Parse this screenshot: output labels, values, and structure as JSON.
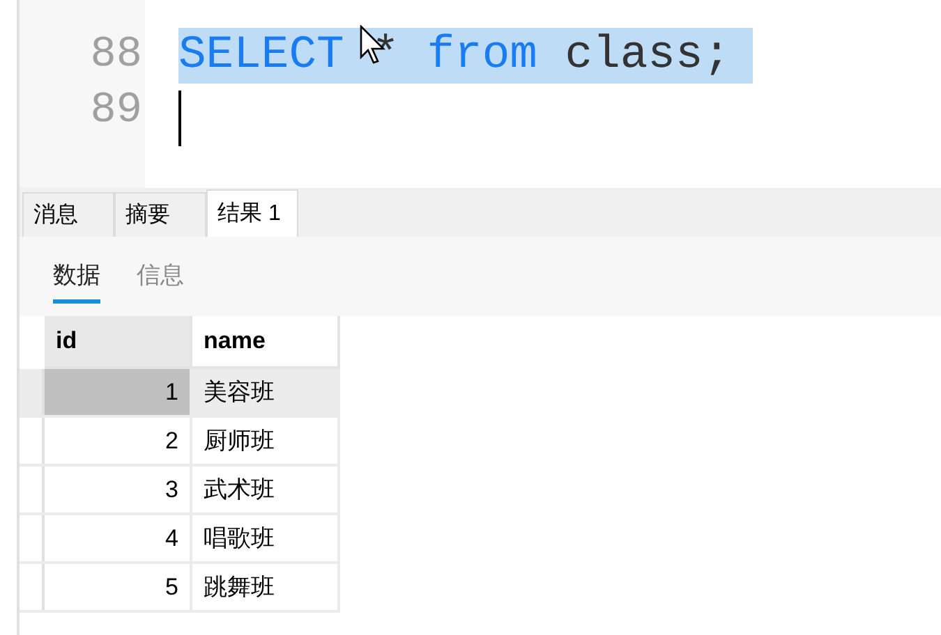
{
  "editor": {
    "lines": [
      {
        "number": "88",
        "tokens": [
          {
            "kind": "keyword",
            "text": "SELECT"
          },
          {
            "kind": "plain",
            "text": " * "
          },
          {
            "kind": "keyword",
            "text": "from"
          },
          {
            "kind": "plain",
            "text": " class;"
          }
        ],
        "selected": true,
        "caret": false
      },
      {
        "number": "89",
        "selected": false,
        "caret": true
      }
    ]
  },
  "result_tabs": [
    {
      "label": "消息",
      "selected": false
    },
    {
      "label": "摘要",
      "selected": false
    },
    {
      "label": "结果 1",
      "selected": true
    }
  ],
  "view_tabs": [
    {
      "label": "数据",
      "selected": true
    },
    {
      "label": "信息",
      "selected": false
    }
  ],
  "table": {
    "columns": [
      "id",
      "name"
    ],
    "rows": [
      {
        "cells": [
          "1",
          "美容班"
        ],
        "selected": true
      },
      {
        "cells": [
          "2",
          "厨师班"
        ],
        "selected": false
      },
      {
        "cells": [
          "3",
          "武术班"
        ],
        "selected": false
      },
      {
        "cells": [
          "4",
          "唱歌班"
        ],
        "selected": false
      },
      {
        "cells": [
          "5",
          "跳舞班"
        ],
        "selected": false
      }
    ]
  }
}
